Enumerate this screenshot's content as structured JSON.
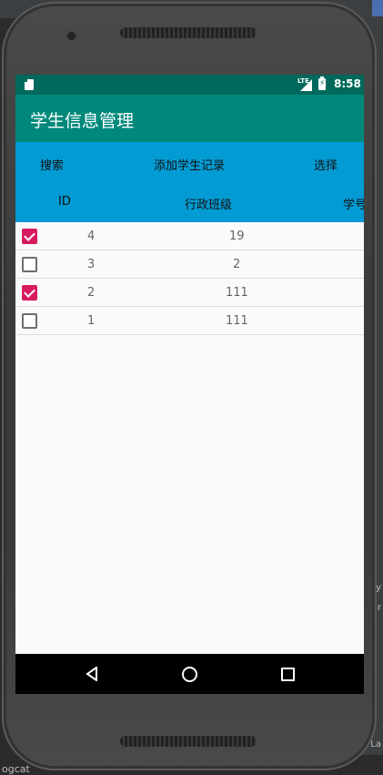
{
  "status_bar": {
    "time": "8:58",
    "network": "LTE"
  },
  "app_bar": {
    "title": "学生信息管理"
  },
  "toolbar": {
    "search_label": "搜索",
    "add_label": "添加学生记录",
    "select_label": "选择"
  },
  "table": {
    "columns": [
      "ID",
      "行政班级",
      "学号"
    ],
    "rows": [
      {
        "checked": true,
        "id": "4",
        "class": "19"
      },
      {
        "checked": false,
        "id": "3",
        "class": "2"
      },
      {
        "checked": true,
        "id": "2",
        "class": "111"
      },
      {
        "checked": false,
        "id": "1",
        "class": "111"
      }
    ]
  },
  "nav_bar": {
    "icons": [
      "back-icon",
      "home-icon",
      "recents-icon"
    ]
  },
  "desktop": {
    "bottom_text": "ogcat",
    "side_text_1": "y",
    "side_text_2": "r",
    "side_text_3": "La"
  },
  "colors": {
    "status_bar": "#00695c",
    "app_bar": "#00897b",
    "toolbar": "#039bd3",
    "checkbox_checked": "#d81b60"
  }
}
